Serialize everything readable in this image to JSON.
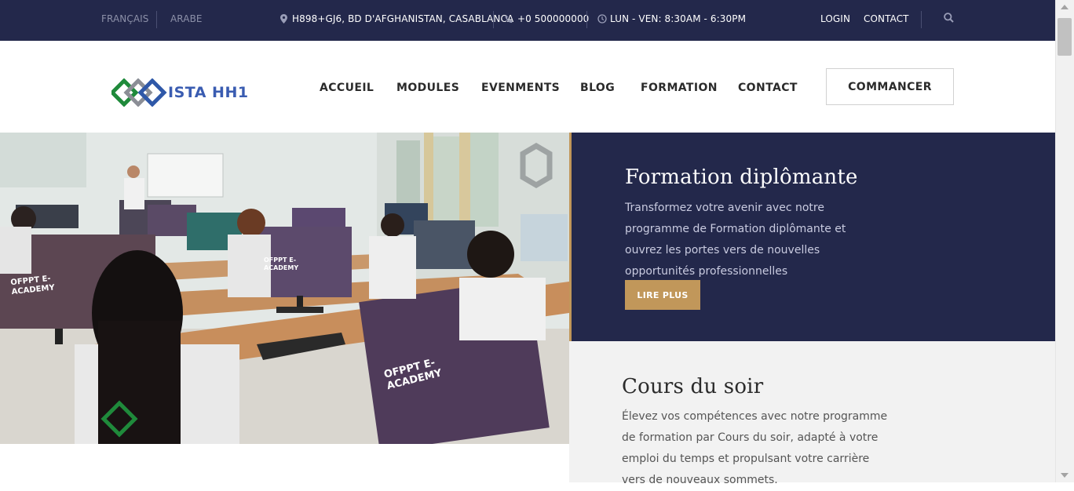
{
  "topbar": {
    "lang_fr": "FRANÇAIS",
    "lang_ar": "ARABE",
    "address": "H898+GJ6, BD D'AFGHANISTAN, CASABLANCA",
    "phone": "+0 500000000",
    "hours": "LUN - VEN: 8:30AM - 6:30PM",
    "login": "LOGIN",
    "contact": "CONTACT",
    "icons": [
      "map-pin-icon",
      "phone-icon",
      "clock-icon",
      "search-icon"
    ]
  },
  "header": {
    "logo_text": "ISTA HH1",
    "nav": [
      "ACCUEIL",
      "MODULES",
      "EVENMENTS",
      "BLOG",
      "FORMATION",
      "CONTACT"
    ],
    "cta": "COMMANCER"
  },
  "hero": {
    "screen_texts": [
      "OFPPT E-ACADEMY",
      "OFPPT E-ACADEMY",
      "OFPPT E-ACADEMY"
    ]
  },
  "panel1": {
    "title": "Formation diplômante",
    "text": "Transformez votre avenir avec notre programme de Formation diplômante et ouvrez les portes vers de nouvelles opportunités professionnelles",
    "button": "LIRE PLUS"
  },
  "panel2": {
    "title": "Cours du soir",
    "text": "Élevez vos compétences avec notre programme de formation par Cours du soir, adapté à votre emploi du temps et propulsant votre carrière vers de nouveaux sommets."
  },
  "colors": {
    "navy": "#23284b",
    "gold": "#c1975a",
    "light_panel": "#f2f2f2"
  }
}
